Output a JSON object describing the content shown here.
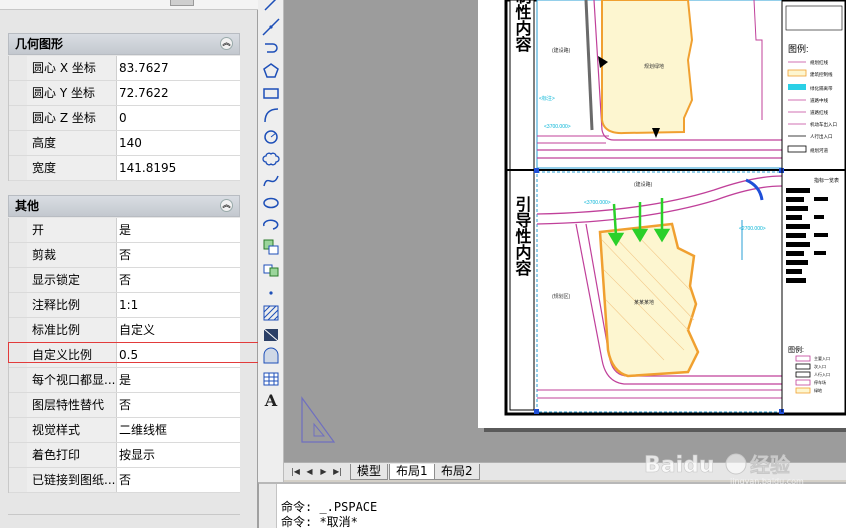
{
  "properties": {
    "geometry_section": {
      "title": "几何图形",
      "rows": [
        {
          "name": "圆心 X 坐标",
          "value": "83.7627"
        },
        {
          "name": "圆心 Y 坐标",
          "value": "72.7622"
        },
        {
          "name": "圆心 Z 坐标",
          "value": "0"
        },
        {
          "name": "高度",
          "value": "140"
        },
        {
          "name": "宽度",
          "value": "141.8195"
        }
      ]
    },
    "other_section": {
      "title": "其他",
      "rows": [
        {
          "name": "开",
          "value": "是"
        },
        {
          "name": "剪裁",
          "value": "否"
        },
        {
          "name": "显示锁定",
          "value": "否"
        },
        {
          "name": "注释比例",
          "value": "1:1"
        },
        {
          "name": "标准比例",
          "value": "自定义"
        },
        {
          "name": "自定义比例",
          "value": "0.5"
        },
        {
          "name": "每个视口都显...",
          "value": "是"
        },
        {
          "name": "图层特性替代",
          "value": "否"
        },
        {
          "name": "视觉样式",
          "value": "二维线框"
        },
        {
          "name": "着色打印",
          "value": "按显示"
        },
        {
          "name": "已链接到图纸...",
          "value": "否"
        }
      ]
    },
    "collapse_glyph": "︽"
  },
  "toolbar": {
    "tools": [
      "line-icon",
      "construction-line-icon",
      "polyline-icon",
      "polygon-icon",
      "rectangle-icon",
      "arc-icon",
      "circle-icon",
      "revision-cloud-icon",
      "spline-icon",
      "ellipse-icon",
      "ellipse-arc-icon",
      "insert-block-icon",
      "make-block-icon",
      "point-icon",
      "hatch-icon",
      "gradient-icon",
      "region-icon",
      "table-icon",
      "multiline-text-icon"
    ],
    "text_tool_glyph": "A"
  },
  "drawing": {
    "upper_heading": "强制性内容",
    "lower_heading": "引导性内容",
    "upper_plot_label": "规划绿地",
    "lower_plot_label": "某某某地",
    "legend_title": "图例:",
    "legend_items": [
      "规划红线",
      "建筑控制线",
      "绿化隔离带",
      "道路中线",
      "道路红线",
      "机动车出入口",
      "人行出入口",
      "规划河道"
    ],
    "legend2_title": "图例:",
    "legend2_items": [
      "主要入口",
      "次入口",
      "人行入口",
      "停车场",
      "绿地"
    ],
    "table_title": "指标一览表",
    "upper_dims": [
      "<标注>",
      "<3700.000>"
    ],
    "lower_dims": [
      "<3700.000>",
      "<2700.000>"
    ],
    "upper_road_label": "(建设路)",
    "lower_road_label": "(建设路)",
    "lower_left_label": "(规划区)"
  },
  "tabs": {
    "items": [
      "模型",
      "布局1",
      "布局2"
    ],
    "active_index": 1
  },
  "command": {
    "lines": [
      "命令: _.PSPACE",
      "命令: *取消*"
    ]
  },
  "watermark": {
    "brand": "Baidu",
    "brand_cn": "经验",
    "url": "jingyan.baidu.com"
  },
  "colors": {
    "highlight": "#e23b3b",
    "canvas_bg": "#9c9c9c",
    "plot_fill": "#fdf6d0",
    "plot_outline": "#f0a030",
    "viewport_border": "#1f4fd8",
    "road_magenta": "#c0409a",
    "arrow_green": "#2ad02a",
    "dim_cyan": "#00b3d6"
  }
}
